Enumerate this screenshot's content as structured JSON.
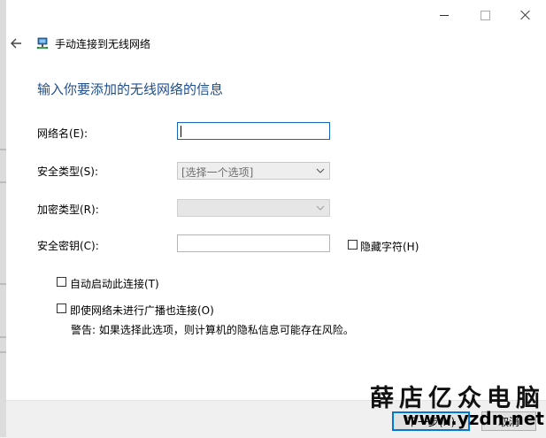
{
  "window": {
    "title": "手动连接到无线网络",
    "minimize_icon": "minimize-icon",
    "maximize_icon": "maximize-icon",
    "close_icon": "close-icon",
    "back_icon": "back-arrow-icon",
    "network_icon": "wireless-network-icon"
  },
  "main": {
    "heading": "输入你要添加的无线网络的信息",
    "network_name": {
      "label": "网络名(E):",
      "value": ""
    },
    "security_type": {
      "label": "安全类型(S):",
      "value": "[选择一个选项]"
    },
    "encryption_type": {
      "label": "加密类型(R):",
      "value": ""
    },
    "security_key": {
      "label": "安全密钥(C):",
      "value": ""
    },
    "hide_chars": {
      "label": "隐藏字符(H)",
      "checked": false
    },
    "auto_start": {
      "label": "自动启动此连接(T)",
      "checked": false
    },
    "connect_hidden": {
      "label": "即使网络未进行广播也连接(O)",
      "checked": false
    },
    "warning": "警告: 如果选择此选项，则计算机的隐私信息可能存在风险。"
  },
  "footer": {
    "next_label": "下一步(N)",
    "cancel_label": "取消"
  },
  "watermark": {
    "chinese": "薛店亿众电脑",
    "url": "www.yzdn.net"
  },
  "colors": {
    "heading": "#1f4e8c",
    "accent": "#0078d7",
    "field_focus": "#1565c0"
  }
}
